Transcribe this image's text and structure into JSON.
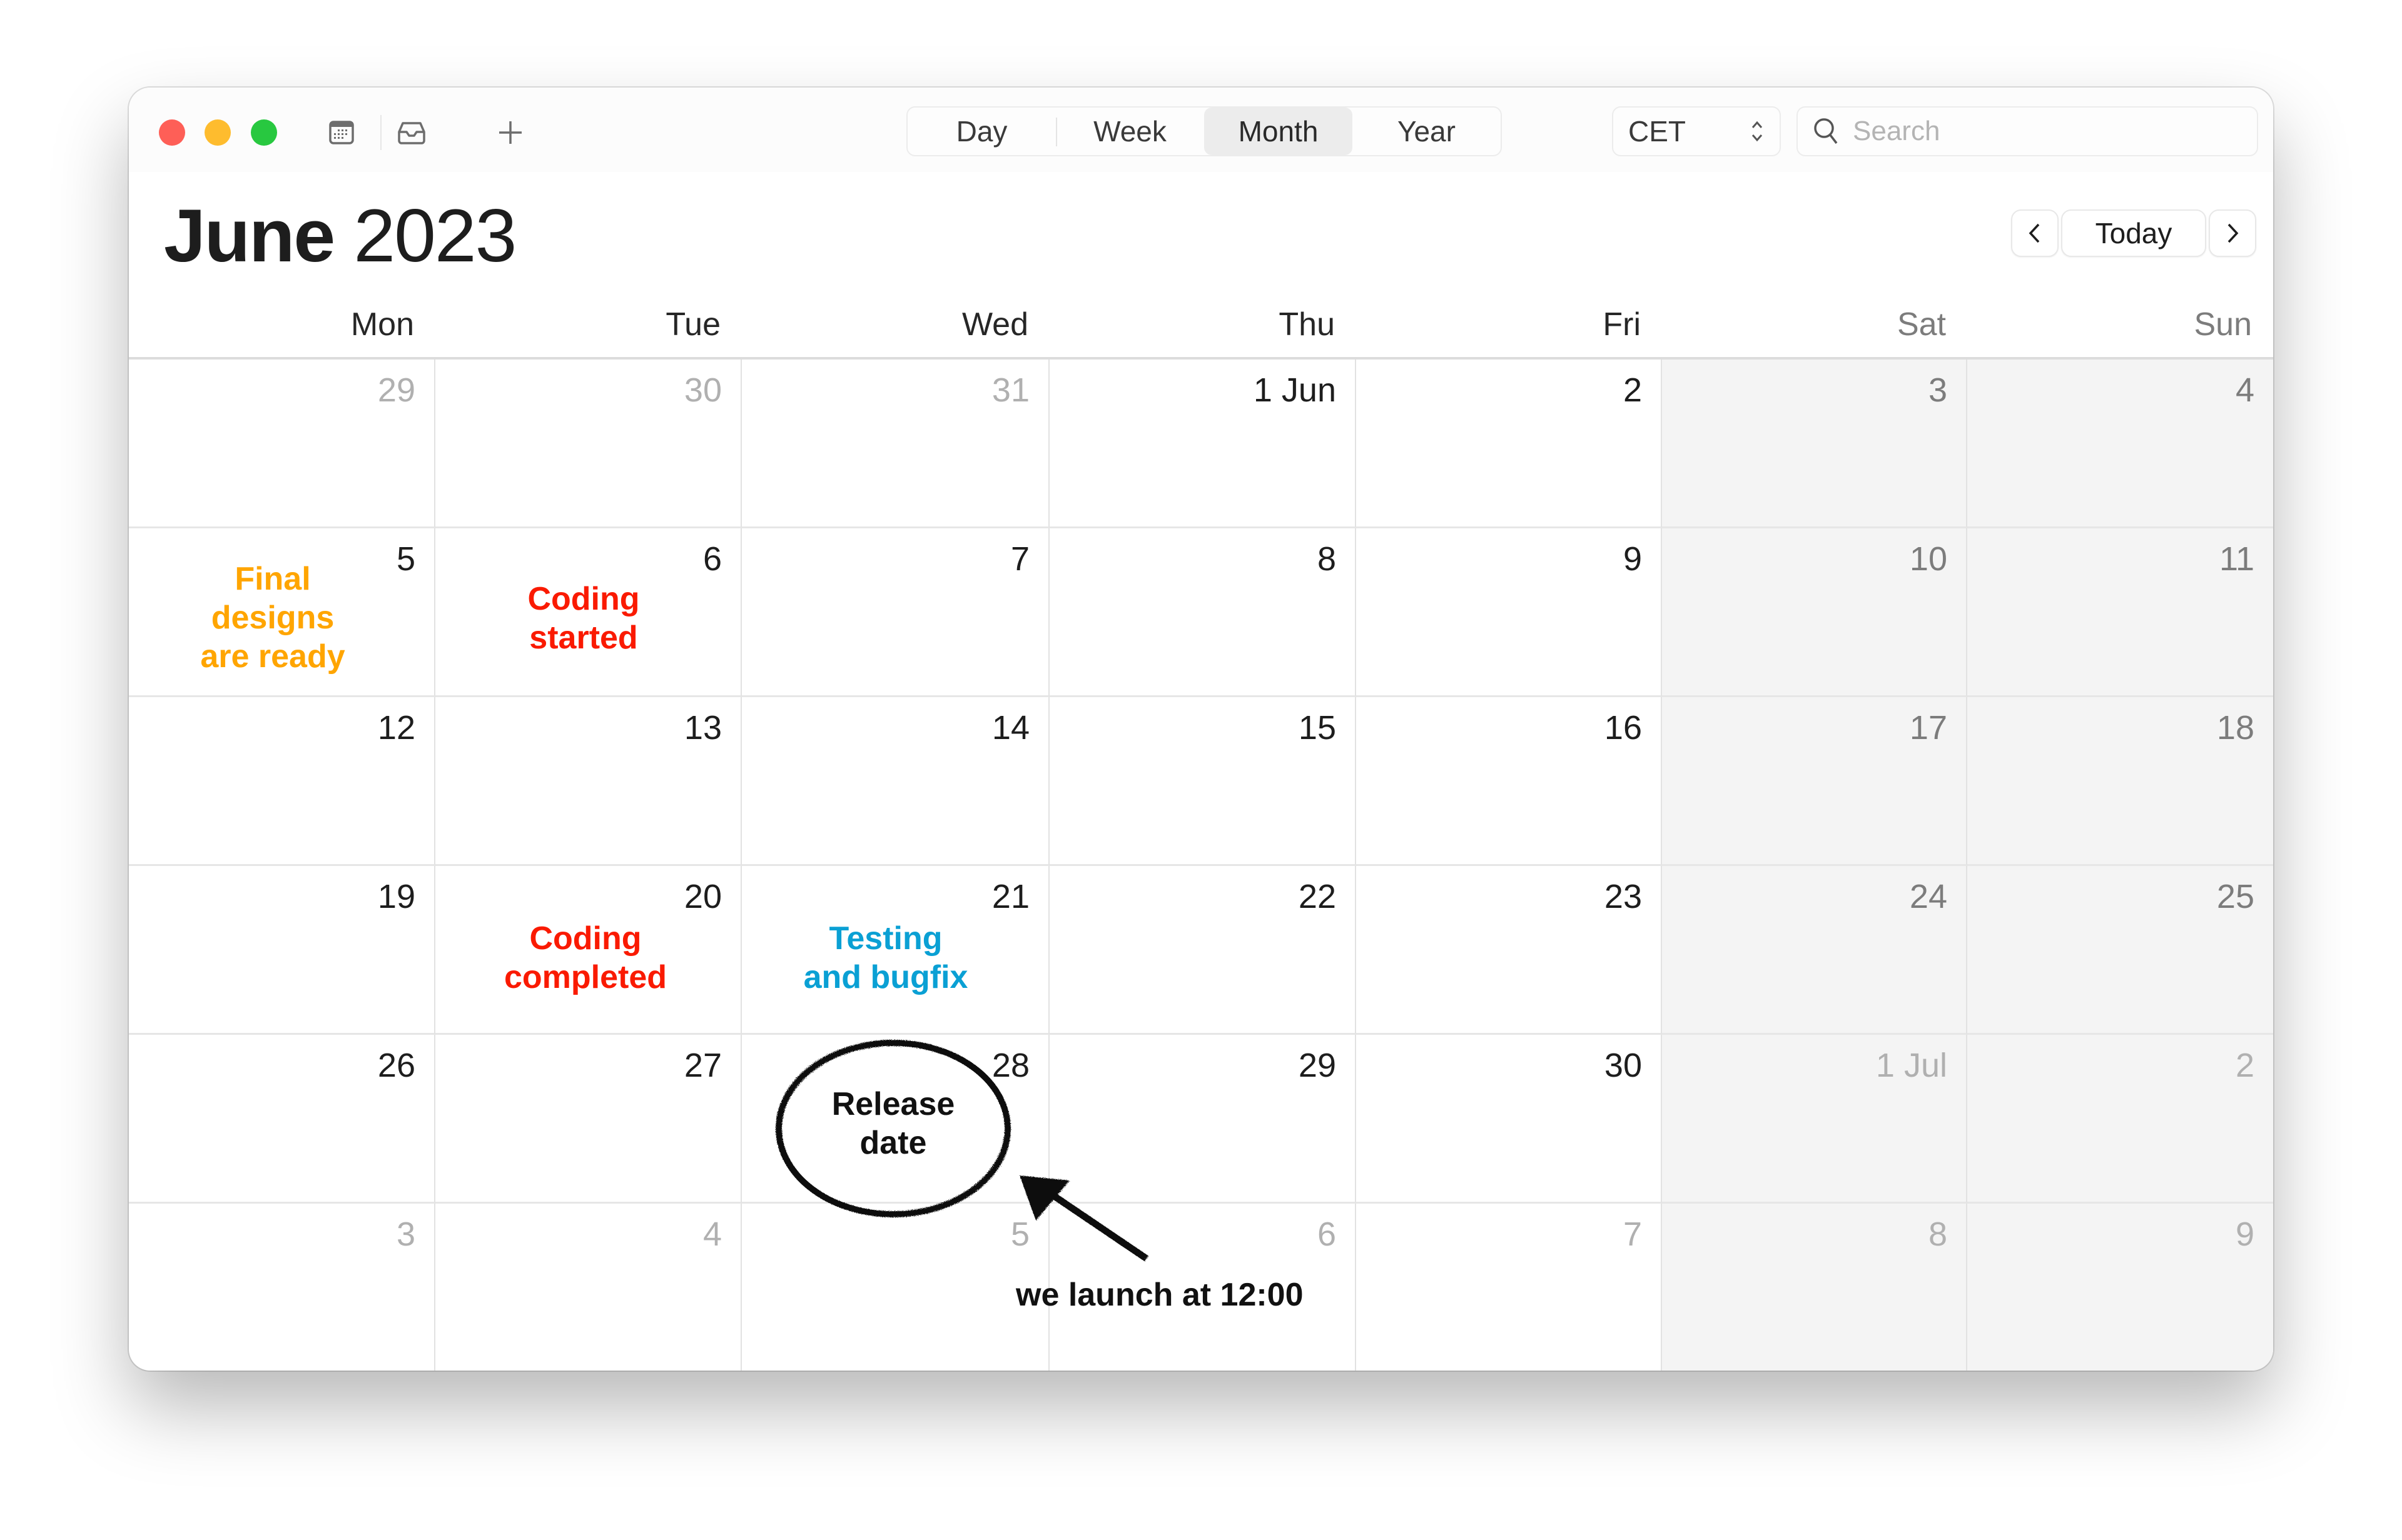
{
  "window": {
    "traffic_lights": [
      {
        "name": "close",
        "color": "#fe5f57"
      },
      {
        "name": "minimize",
        "color": "#febc2e"
      },
      {
        "name": "zoom",
        "color": "#28c840"
      }
    ],
    "toolbar": {
      "calendars_icon": "calendar-list-icon",
      "inbox_icon": "inbox-icon",
      "add_icon": "plus-icon",
      "views": [
        {
          "label": "Day",
          "active": false
        },
        {
          "label": "Week",
          "active": false
        },
        {
          "label": "Month",
          "active": true
        },
        {
          "label": "Year",
          "active": false
        }
      ],
      "timezone": "CET",
      "search_placeholder": "Search"
    }
  },
  "header": {
    "month": "June",
    "year": "2023",
    "nav": {
      "prev": "‹",
      "today": "Today",
      "next": "›"
    }
  },
  "weekdays": [
    "Mon",
    "Tue",
    "Wed",
    "Thu",
    "Fri",
    "Sat",
    "Sun"
  ],
  "weeks": [
    [
      {
        "d": "29",
        "muted": true
      },
      {
        "d": "30",
        "muted": true
      },
      {
        "d": "31",
        "muted": true
      },
      {
        "d": "1 Jun",
        "muted": false
      },
      {
        "d": "2",
        "muted": false
      },
      {
        "d": "3",
        "muted": false
      },
      {
        "d": "4",
        "muted": false
      }
    ],
    [
      {
        "d": "5",
        "muted": false
      },
      {
        "d": "6",
        "muted": false
      },
      {
        "d": "7",
        "muted": false
      },
      {
        "d": "8",
        "muted": false
      },
      {
        "d": "9",
        "muted": false
      },
      {
        "d": "10",
        "muted": false
      },
      {
        "d": "11",
        "muted": false
      }
    ],
    [
      {
        "d": "12",
        "muted": false
      },
      {
        "d": "13",
        "muted": false
      },
      {
        "d": "14",
        "muted": false
      },
      {
        "d": "15",
        "muted": false
      },
      {
        "d": "16",
        "muted": false
      },
      {
        "d": "17",
        "muted": false
      },
      {
        "d": "18",
        "muted": false
      }
    ],
    [
      {
        "d": "19",
        "muted": false
      },
      {
        "d": "20",
        "muted": false
      },
      {
        "d": "21",
        "muted": false
      },
      {
        "d": "22",
        "muted": false
      },
      {
        "d": "23",
        "muted": false
      },
      {
        "d": "24",
        "muted": false
      },
      {
        "d": "25",
        "muted": false
      }
    ],
    [
      {
        "d": "26",
        "muted": false
      },
      {
        "d": "27",
        "muted": false
      },
      {
        "d": "28",
        "muted": false
      },
      {
        "d": "29",
        "muted": false
      },
      {
        "d": "30",
        "muted": false
      },
      {
        "d": "1 Jul",
        "muted": true
      },
      {
        "d": "2",
        "muted": true
      }
    ],
    [
      {
        "d": "3",
        "muted": true
      },
      {
        "d": "4",
        "muted": true
      },
      {
        "d": "5",
        "muted": true
      },
      {
        "d": "6",
        "muted": true
      },
      {
        "d": "7",
        "muted": true
      },
      {
        "d": "8",
        "muted": true
      },
      {
        "d": "9",
        "muted": true
      }
    ]
  ],
  "annotations": {
    "colors": {
      "design": "#ffa500",
      "coding": "#fa1a00",
      "testing": "#0aa0d4",
      "release": "#111111"
    },
    "labels": {
      "final_designs": [
        "Final",
        "designs",
        "are ready"
      ],
      "coding_started": [
        "Coding",
        "started"
      ],
      "coding_completed": [
        "Coding",
        "completed"
      ],
      "testing": [
        "Testing",
        "and bugfix"
      ],
      "release": [
        "Release",
        "date"
      ],
      "launch_note": "we launch at 12:00"
    }
  }
}
